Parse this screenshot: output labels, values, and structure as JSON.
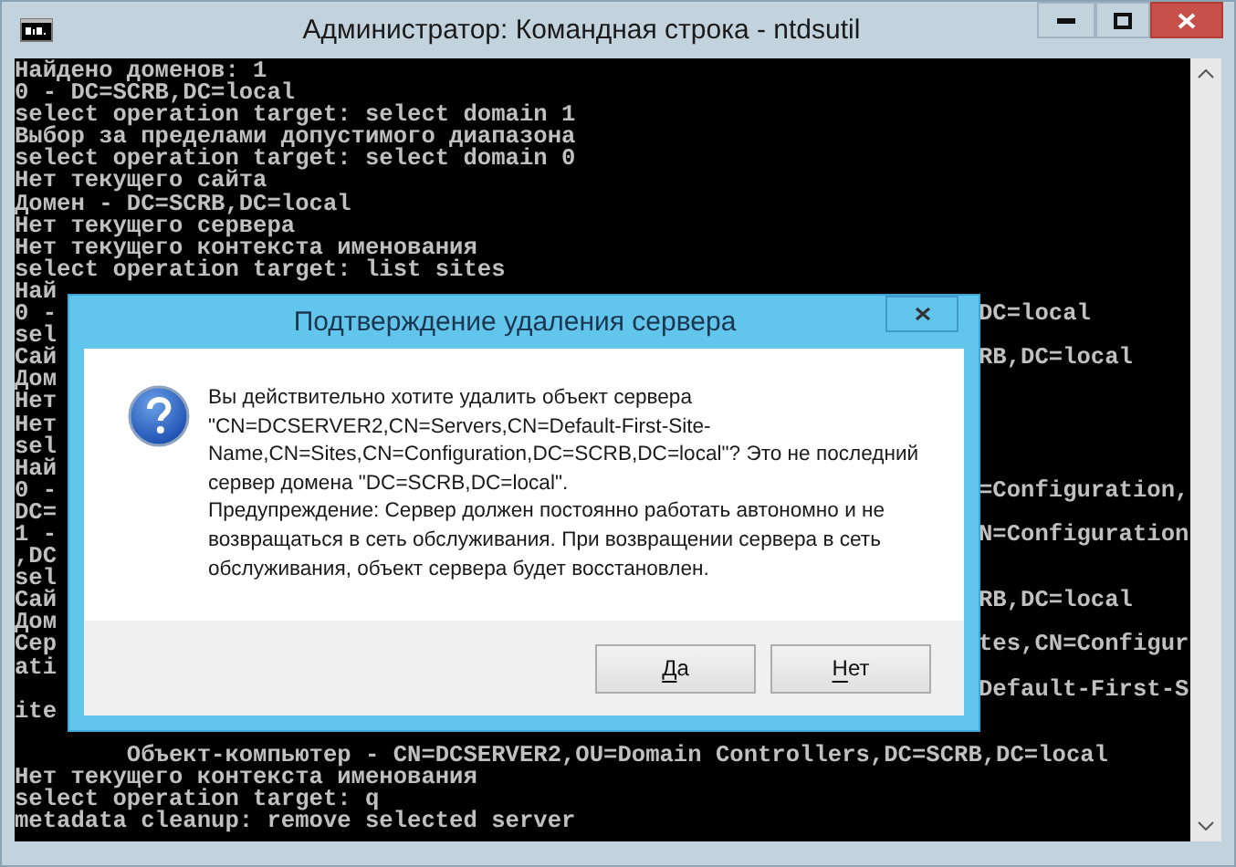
{
  "window": {
    "title": "Администратор: Командная строка - ntdsutil"
  },
  "console": {
    "lines": [
      {
        "kind": "text",
        "text": "Найдено доменов: 1"
      },
      {
        "kind": "text",
        "text": "0 - DC=SCRB,DC=local"
      },
      {
        "kind": "text",
        "text": "select operation target: select domain 1"
      },
      {
        "kind": "text",
        "text": "Выбор за пределами допустимого диапазона"
      },
      {
        "kind": "text",
        "text": "select operation target: select domain 0"
      },
      {
        "kind": "text",
        "text": "Нет текущего сайта"
      },
      {
        "kind": "text",
        "text": "Домен - DC=SCRB,DC=local"
      },
      {
        "kind": "text",
        "text": "Нет текущего сервера"
      },
      {
        "kind": "text",
        "text": "Нет текущего контекста именования"
      },
      {
        "kind": "text",
        "text": "select operation target: list sites"
      },
      {
        "kind": "covered",
        "left": "Най"
      },
      {
        "kind": "covered",
        "left": "0 -",
        "right": "DC=local"
      },
      {
        "kind": "covered",
        "left": "sel"
      },
      {
        "kind": "covered",
        "left": "Сай",
        "right": "RB,DC=local"
      },
      {
        "kind": "covered",
        "left": "Дом"
      },
      {
        "kind": "covered",
        "left": "Нет"
      },
      {
        "kind": "covered",
        "left": "Нет"
      },
      {
        "kind": "covered",
        "left": "sel"
      },
      {
        "kind": "covered",
        "left": "Най"
      },
      {
        "kind": "covered",
        "left": "0 -",
        "right": "=Configuration,"
      },
      {
        "kind": "covered",
        "left": "DC="
      },
      {
        "kind": "covered",
        "left": "1 -",
        "right": "N=Configuration"
      },
      {
        "kind": "covered",
        "left": ",DC"
      },
      {
        "kind": "covered",
        "left": "sel"
      },
      {
        "kind": "covered",
        "left": "Сай",
        "right": "RB,DC=local"
      },
      {
        "kind": "covered",
        "left": "Дом"
      },
      {
        "kind": "covered",
        "left": "Сер",
        "right": "tes,CN=Configur"
      },
      {
        "kind": "covered",
        "left": "ati"
      },
      {
        "kind": "covered",
        "right": "Default-First-S"
      },
      {
        "kind": "covered",
        "left": "ite"
      },
      {
        "kind": "blank"
      },
      {
        "kind": "text",
        "text": "        Объект-компьютер - CN=DCSERVER2,OU=Domain Controllers,DC=SCRB,DC=local"
      },
      {
        "kind": "text",
        "text": "Нет текущего контекста именования"
      },
      {
        "kind": "text",
        "text": "select operation target: q"
      },
      {
        "kind": "text",
        "text": "metadata cleanup: remove selected server"
      }
    ]
  },
  "dialog": {
    "title": "Подтверждение удаления сервера",
    "message": "Вы действительно хотите удалить объект сервера \"CN=DCSERVER2,CN=Servers,CN=Default-First-Site-Name,CN=Sites,CN=Configuration,DC=SCRB,DC=local\"?  Это не последний сервер домена \"DC=SCRB,DC=local\".",
    "warning": "Предупреждение: Сервер должен постоянно работать автономно и не возвращаться в сеть обслуживания. При возвращении сервера в сеть обслуживания, объект сервера будет восстановлен.",
    "buttons": [
      {
        "label": "Да",
        "underline_first": true
      },
      {
        "label": "Нет",
        "underline_first": true
      }
    ]
  }
}
